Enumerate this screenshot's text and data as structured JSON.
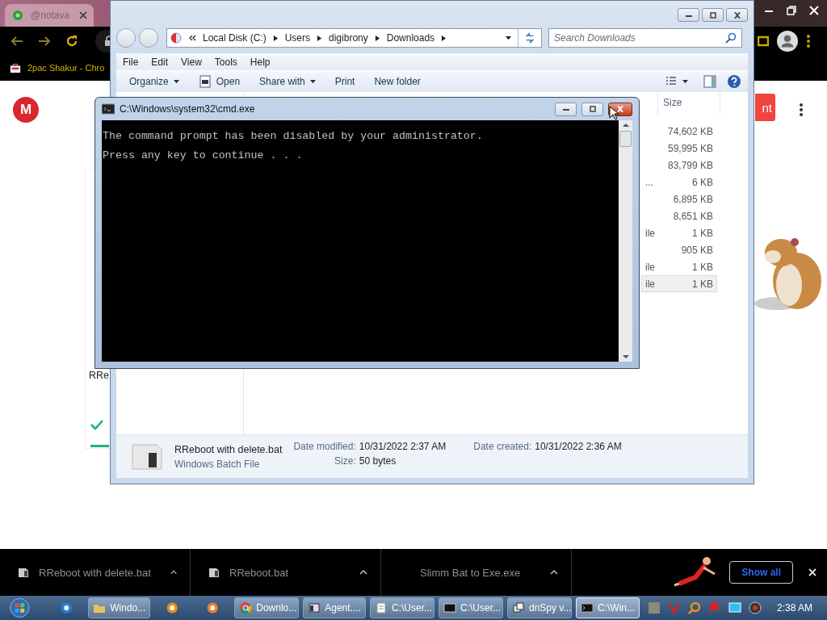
{
  "browser": {
    "tab_title": "@notava",
    "bookmark": "2pac Shakur - Chro",
    "logo_letter": "M",
    "card_text": "RRe",
    "button_text": "nt"
  },
  "explorer": {
    "breadcrumb": [
      "Local Disk (C:)",
      "Users",
      "digibrony",
      "Downloads"
    ],
    "search_placeholder": "Search Downloads",
    "menu": [
      "File",
      "Edit",
      "View",
      "Tools",
      "Help"
    ],
    "commands": [
      {
        "label": "Organize",
        "dropdown": true
      },
      {
        "label": "Open",
        "dropdown": false
      },
      {
        "label": "Share with",
        "dropdown": true
      },
      {
        "label": "Print",
        "dropdown": false
      },
      {
        "label": "New folder",
        "dropdown": false
      }
    ],
    "column": "Size",
    "rows": [
      {
        "size": "74,602 KB",
        "selected": false
      },
      {
        "size": "59,995 KB",
        "selected": false
      },
      {
        "size": "83,799 KB",
        "selected": false
      },
      {
        "name": "...",
        "size": "6 KB",
        "selected": false
      },
      {
        "size": "6,895 KB",
        "selected": false
      },
      {
        "size": "8,651 KB",
        "selected": false
      },
      {
        "name": "ile",
        "size": "1 KB",
        "selected": false
      },
      {
        "size": "905 KB",
        "selected": false
      },
      {
        "name": "ile",
        "size": "1 KB",
        "selected": false
      },
      {
        "name": "ile",
        "size": "1 KB",
        "selected": true
      }
    ],
    "details": {
      "name": "RReboot with delete.bat",
      "type": "Windows Batch File",
      "modified_label": "Date modified:",
      "modified": "10/31/2022 2:37 AM",
      "size_label": "Size:",
      "size": "50 bytes",
      "created_label": "Date created:",
      "created": "10/31/2022 2:36 AM"
    }
  },
  "cmd": {
    "title": "C:\\Windows\\system32\\cmd.exe",
    "lines": [
      "The command prompt has been disabled by your administrator.",
      "Press any key to continue . . ."
    ]
  },
  "downloads": {
    "items": [
      {
        "name": "RReboot with delete.bat"
      },
      {
        "name": "RReboot.bat"
      },
      {
        "name": "Slimm Bat to Exe.exe"
      }
    ],
    "show_all": "Show all"
  },
  "taskbar": {
    "items": [
      {
        "kind": "launcher"
      },
      {
        "kind": "button",
        "label": "Windo...",
        "selected": false
      },
      {
        "kind": "launcher"
      },
      {
        "kind": "launcher"
      },
      {
        "kind": "button",
        "label": "Downlo...",
        "selected": false
      },
      {
        "kind": "button",
        "label": "Agent....",
        "selected": false
      },
      {
        "kind": "button",
        "label": "C:\\User...",
        "selected": false
      },
      {
        "kind": "button",
        "label": "C:\\User...",
        "selected": false
      },
      {
        "kind": "button",
        "label": "dnSpy v...",
        "selected": false
      },
      {
        "kind": "button",
        "label": "C:\\Win...",
        "selected": true
      }
    ],
    "clock": "2:38 AM"
  }
}
